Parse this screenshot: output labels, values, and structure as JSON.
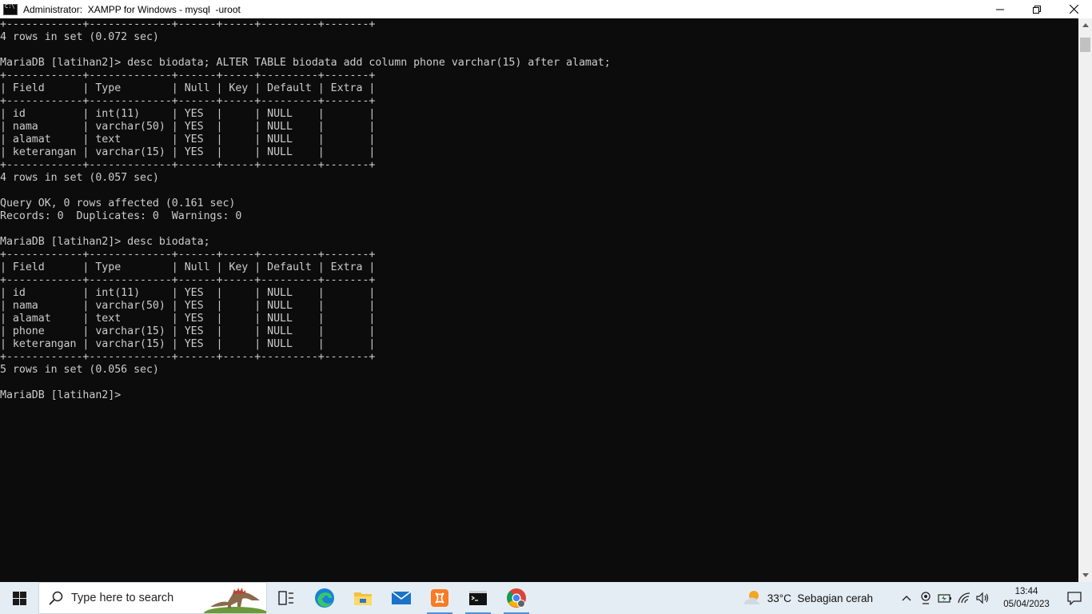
{
  "window": {
    "title": "Administrator:  XAMPP for Windows - mysql  -uroot",
    "minimize_glyph": "–",
    "close_glyph": "✕"
  },
  "console": {
    "lines": [
      "+------------+-------------+------+-----+---------+-------+",
      "4 rows in set (0.072 sec)",
      "",
      "MariaDB [latihan2]> desc biodata; ALTER TABLE biodata add column phone varchar(15) after alamat;",
      "+------------+-------------+------+-----+---------+-------+",
      "| Field      | Type        | Null | Key | Default | Extra |",
      "+------------+-------------+------+-----+---------+-------+",
      "| id         | int(11)     | YES  |     | NULL    |       |",
      "| nama       | varchar(50) | YES  |     | NULL    |       |",
      "| alamat     | text        | YES  |     | NULL    |       |",
      "| keterangan | varchar(15) | YES  |     | NULL    |       |",
      "+------------+-------------+------+-----+---------+-------+",
      "4 rows in set (0.057 sec)",
      "",
      "Query OK, 0 rows affected (0.161 sec)",
      "Records: 0  Duplicates: 0  Warnings: 0",
      "",
      "MariaDB [latihan2]> desc biodata;",
      "+------------+-------------+------+-----+---------+-------+",
      "| Field      | Type        | Null | Key | Default | Extra |",
      "+------------+-------------+------+-----+---------+-------+",
      "| id         | int(11)     | YES  |     | NULL    |       |",
      "| nama       | varchar(50) | YES  |     | NULL    |       |",
      "| alamat     | text        | YES  |     | NULL    |       |",
      "| phone      | varchar(15) | YES  |     | NULL    |       |",
      "| keterangan | varchar(15) | YES  |     | NULL    |       |",
      "+------------+-------------+------+-----+---------+-------+",
      "5 rows in set (0.056 sec)",
      "",
      "MariaDB [latihan2]>"
    ],
    "text_color": "#cccccc",
    "background": "#0c0c0c"
  },
  "taskbar": {
    "search_placeholder": "Type here to search",
    "pinned": [
      "start-windows-icon",
      "task-view-icon",
      "edge-icon",
      "file-explorer-icon",
      "mail-icon",
      "xampp-icon",
      "terminal-icon",
      "chrome-icon"
    ],
    "weather": {
      "temperature": "33°C",
      "condition": "Sebagian cerah"
    },
    "clock": {
      "time": "13:44",
      "date": "05/04/2023"
    },
    "accent": "#4e8fd6"
  }
}
